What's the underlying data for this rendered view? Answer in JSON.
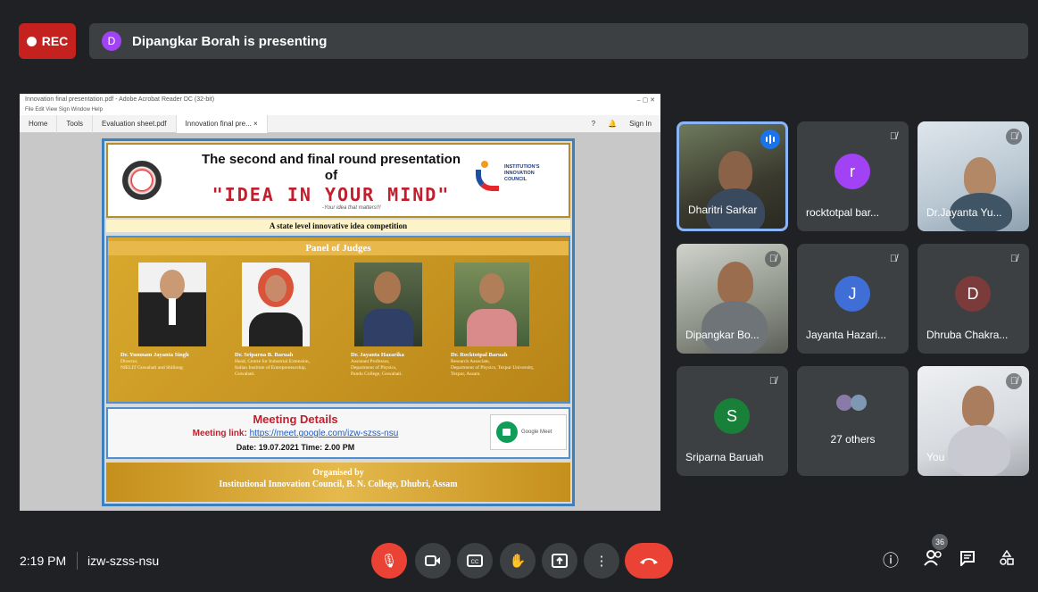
{
  "top": {
    "rec_label": "REC",
    "presenter_initial": "D",
    "presenting_text": "Dipangkar Borah is presenting"
  },
  "shared": {
    "window_title": "Innovation final presentation.pdf - Adobe Acrobat Reader DC (32-bit)",
    "menu": "File  Edit  View  Sign  Window  Help",
    "tabs": [
      "Home",
      "Tools",
      "Evaluation sheet.pdf",
      "Innovation final pre... ×"
    ],
    "signin": "Sign In",
    "poster": {
      "title1": "The second and final round presentation",
      "of": "of",
      "idea": "\"IDEA IN YOUR MIND\"",
      "tagline": "-Your idea that matters!!!",
      "iic_text": "INSTITUTION'S\nINNOVATION\nCOUNCIL",
      "subtitle": "A state level innovative idea competition",
      "panel_title": "Panel of Judges",
      "judges": [
        {
          "name": "Dr. Yumnam Jayanta Singh",
          "role": "Director,\nNIELIT Guwahati and Shillong"
        },
        {
          "name": "Dr. Sriparna B. Baruah",
          "role": "Head, Centre for Industrial Extension,\nIndian Institute of Entrepreneurship,\nGuwahati."
        },
        {
          "name": "Dr. Jayanta Hazarika",
          "role": "Assistant Professor,\nDepartment of Physics,\nPandu College, Guwahati."
        },
        {
          "name": "Dr. Rocktotpal Baruah",
          "role": "Research Associate,\nDepartment of Physics, Tezpur University,\nTezpur, Assam."
        }
      ],
      "meeting_title": "Meeting Details",
      "meeting_link_label": "Meeting link:",
      "meeting_link": "https://meet.google.com/izw-szss-nsu",
      "meeting_date": "Date: 19.07.2021 Time: 2.00 PM",
      "gmeet_label": "Google Meet",
      "organised_by": "Organised by",
      "organiser": "Institutional Innovation Council, B. N. College, Dhubri, Assam"
    }
  },
  "participants": [
    {
      "name": "Dharitri Sarkar",
      "type": "video"
    },
    {
      "name": "rocktotpal bar...",
      "initial": "r",
      "color": "#a142f4"
    },
    {
      "name": "Dr.Jayanta Yu...",
      "type": "video"
    },
    {
      "name": "Dipangkar Bo...",
      "type": "video"
    },
    {
      "name": "Jayanta Hazari...",
      "initial": "J",
      "color": "#3f6fd6"
    },
    {
      "name": "Dhruba Chakra...",
      "initial": "D",
      "color": "#7b3b3b"
    },
    {
      "name": "Sriparna Baruah",
      "initial": "S",
      "color": "#188038"
    },
    {
      "name": "27 others",
      "type": "group"
    },
    {
      "name": "You",
      "type": "video"
    }
  ],
  "bottom": {
    "time": "2:19 PM",
    "meeting_code": "izw-szss-nsu",
    "people_count": "36"
  },
  "colors": {
    "background": "#202124",
    "tile": "#3c4043",
    "rec": "#c5221f",
    "hangup": "#ea4335",
    "active_speaker": "#8ab4f8"
  }
}
